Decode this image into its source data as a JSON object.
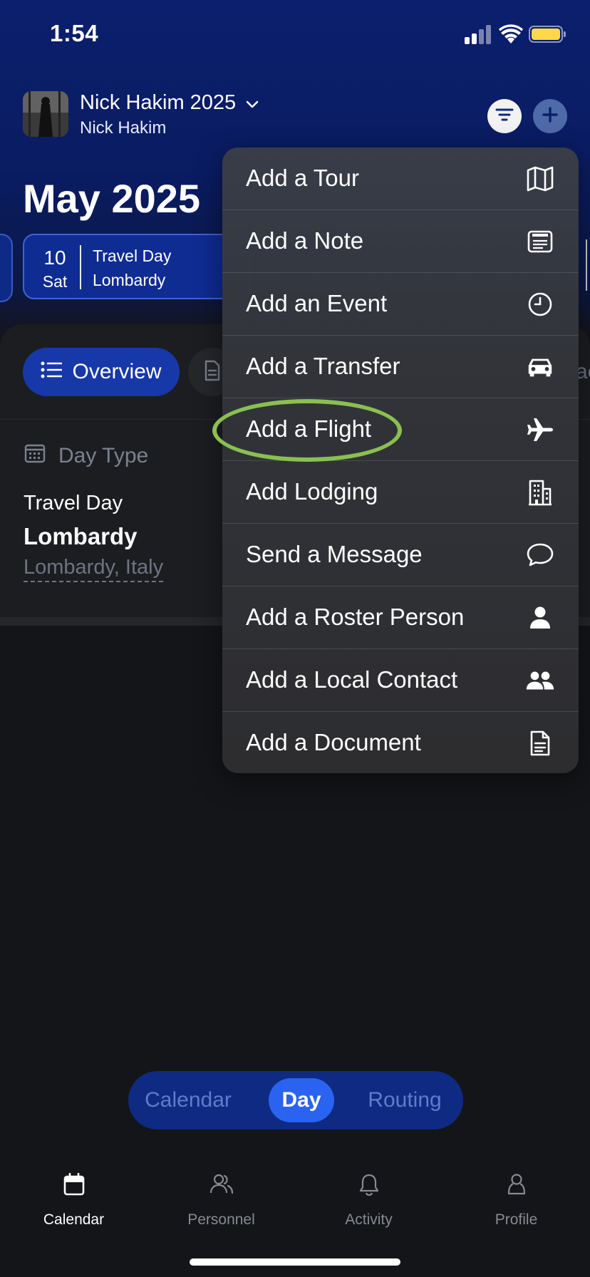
{
  "status_bar": {
    "time": "1:54"
  },
  "header": {
    "project_title": "Nick Hakim 2025",
    "project_subtitle": "Nick Hakim"
  },
  "month_title": "May 2025",
  "day_card": {
    "day_number": "10",
    "weekday": "Sat",
    "line1": "Travel Day",
    "line2": "Lombardy"
  },
  "tabs": {
    "overview_label": "Overview",
    "partial_next": "ac"
  },
  "day_type": {
    "label": "Day Type",
    "type": "Travel Day",
    "name": "Lombardy",
    "location": "Lombardy, Italy"
  },
  "menu": {
    "items": [
      {
        "label": "Add a Tour",
        "icon": "map-icon"
      },
      {
        "label": "Add a Note",
        "icon": "note-icon"
      },
      {
        "label": "Add an Event",
        "icon": "clock-icon"
      },
      {
        "label": "Add a Transfer",
        "icon": "car-icon"
      },
      {
        "label": "Add a Flight",
        "icon": "airplane-icon",
        "highlighted": true
      },
      {
        "label": "Add Lodging",
        "icon": "building-icon"
      },
      {
        "label": "Send a Message",
        "icon": "chat-bubble-icon"
      },
      {
        "label": "Add a Roster Person",
        "icon": "person-icon"
      },
      {
        "label": "Add a Local Contact",
        "icon": "people-icon"
      },
      {
        "label": "Add a Document",
        "icon": "document-icon"
      }
    ],
    "highlight_color": "#8ac04f"
  },
  "segment": {
    "items": [
      "Calendar",
      "Day",
      "Routing"
    ],
    "active": "Day"
  },
  "tab_bar": {
    "items": [
      {
        "label": "Calendar",
        "icon": "calendar-icon",
        "active": true
      },
      {
        "label": "Personnel",
        "icon": "people-outline-icon"
      },
      {
        "label": "Activity",
        "icon": "bell-icon"
      },
      {
        "label": "Profile",
        "icon": "profile-icon"
      }
    ]
  },
  "colors": {
    "accent": "#2a63f0",
    "header_bg": "#0b1f6e",
    "battery": "#ffd84a"
  }
}
